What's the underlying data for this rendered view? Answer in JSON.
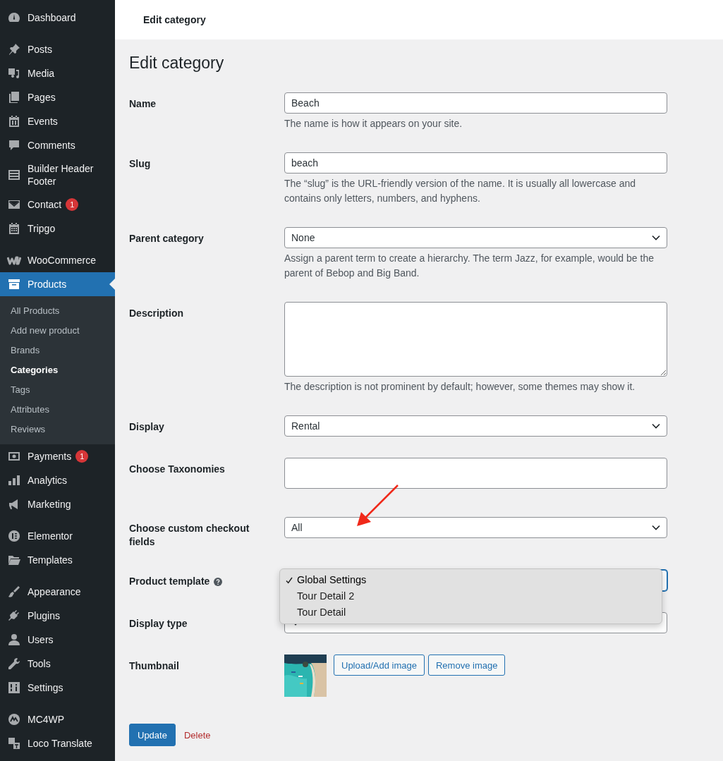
{
  "sidebar": {
    "groups": [
      {
        "items": [
          {
            "label": "Dashboard",
            "selected": false
          }
        ]
      },
      {
        "items": [
          {
            "label": "Posts",
            "selected": false
          },
          {
            "label": "Media",
            "selected": false
          },
          {
            "label": "Pages",
            "selected": false
          },
          {
            "label": "Events",
            "selected": false
          },
          {
            "label": "Comments",
            "selected": false
          },
          {
            "label": "Builder Header Footer",
            "selected": false
          },
          {
            "label": "Contact",
            "selected": false,
            "badge": "1"
          },
          {
            "label": "Tripgo",
            "selected": false
          }
        ]
      },
      {
        "items": [
          {
            "label": "WooCommerce",
            "selected": false
          },
          {
            "label": "Products",
            "selected": true,
            "children": [
              {
                "label": "All Products",
                "selected": false
              },
              {
                "label": "Add new product",
                "selected": false
              },
              {
                "label": "Brands",
                "selected": false
              },
              {
                "label": "Categories",
                "selected": true
              },
              {
                "label": "Tags",
                "selected": false
              },
              {
                "label": "Attributes",
                "selected": false
              },
              {
                "label": "Reviews",
                "selected": false
              }
            ]
          },
          {
            "label": "Payments",
            "selected": false,
            "badge": "1"
          },
          {
            "label": "Analytics",
            "selected": false
          },
          {
            "label": "Marketing",
            "selected": false
          }
        ]
      },
      {
        "items": [
          {
            "label": "Elementor",
            "selected": false
          },
          {
            "label": "Templates",
            "selected": false
          }
        ]
      },
      {
        "items": [
          {
            "label": "Appearance",
            "selected": false
          },
          {
            "label": "Plugins",
            "selected": false
          },
          {
            "label": "Users",
            "selected": false
          },
          {
            "label": "Tools",
            "selected": false
          },
          {
            "label": "Settings",
            "selected": false
          }
        ]
      },
      {
        "items": [
          {
            "label": "MC4WP",
            "selected": false
          },
          {
            "label": "Loco Translate",
            "selected": false
          }
        ]
      }
    ]
  },
  "header": {
    "title": "Edit category"
  },
  "page_title": "Edit category",
  "form": [
    {
      "kind": "text",
      "label": "Name",
      "value": "Beach",
      "description": "The name is how it appears on your site."
    },
    {
      "kind": "text",
      "label": "Slug",
      "value": "beach",
      "description": "The “slug” is the URL-friendly version of the name. It is usually all lowercase and contains only letters, numbers, and hyphens."
    },
    {
      "kind": "select",
      "label": "Parent category",
      "value": "None",
      "description": "Assign a parent term to create a hierarchy. The term Jazz, for example, would be the parent of Bebop and Big Band."
    },
    {
      "kind": "textarea",
      "label": "Description",
      "description": "The description is not prominent by default; however, some themes may show it."
    },
    {
      "kind": "select",
      "label": "Display",
      "value": "Rental"
    },
    {
      "kind": "tags",
      "label": "Choose Taxonomies"
    },
    {
      "kind": "select",
      "label": "Choose custom checkout fields",
      "value": "All"
    },
    {
      "kind": "select",
      "label": "Product template",
      "help": true,
      "dropdown": {
        "options": [
          {
            "label": "Global Settings",
            "selected": true
          },
          {
            "label": "Tour Detail 2",
            "selected": false
          },
          {
            "label": "Tour Detail",
            "selected": false
          }
        ]
      }
    },
    {
      "kind": "select",
      "label": "Display type"
    },
    {
      "label": "Thumbnail",
      "image": {
        "kind": "picture"
      },
      "buttons": [
        "Upload/Add image",
        "Remove image"
      ]
    }
  ],
  "actions": {
    "update": "Update",
    "delete": "Delete"
  }
}
